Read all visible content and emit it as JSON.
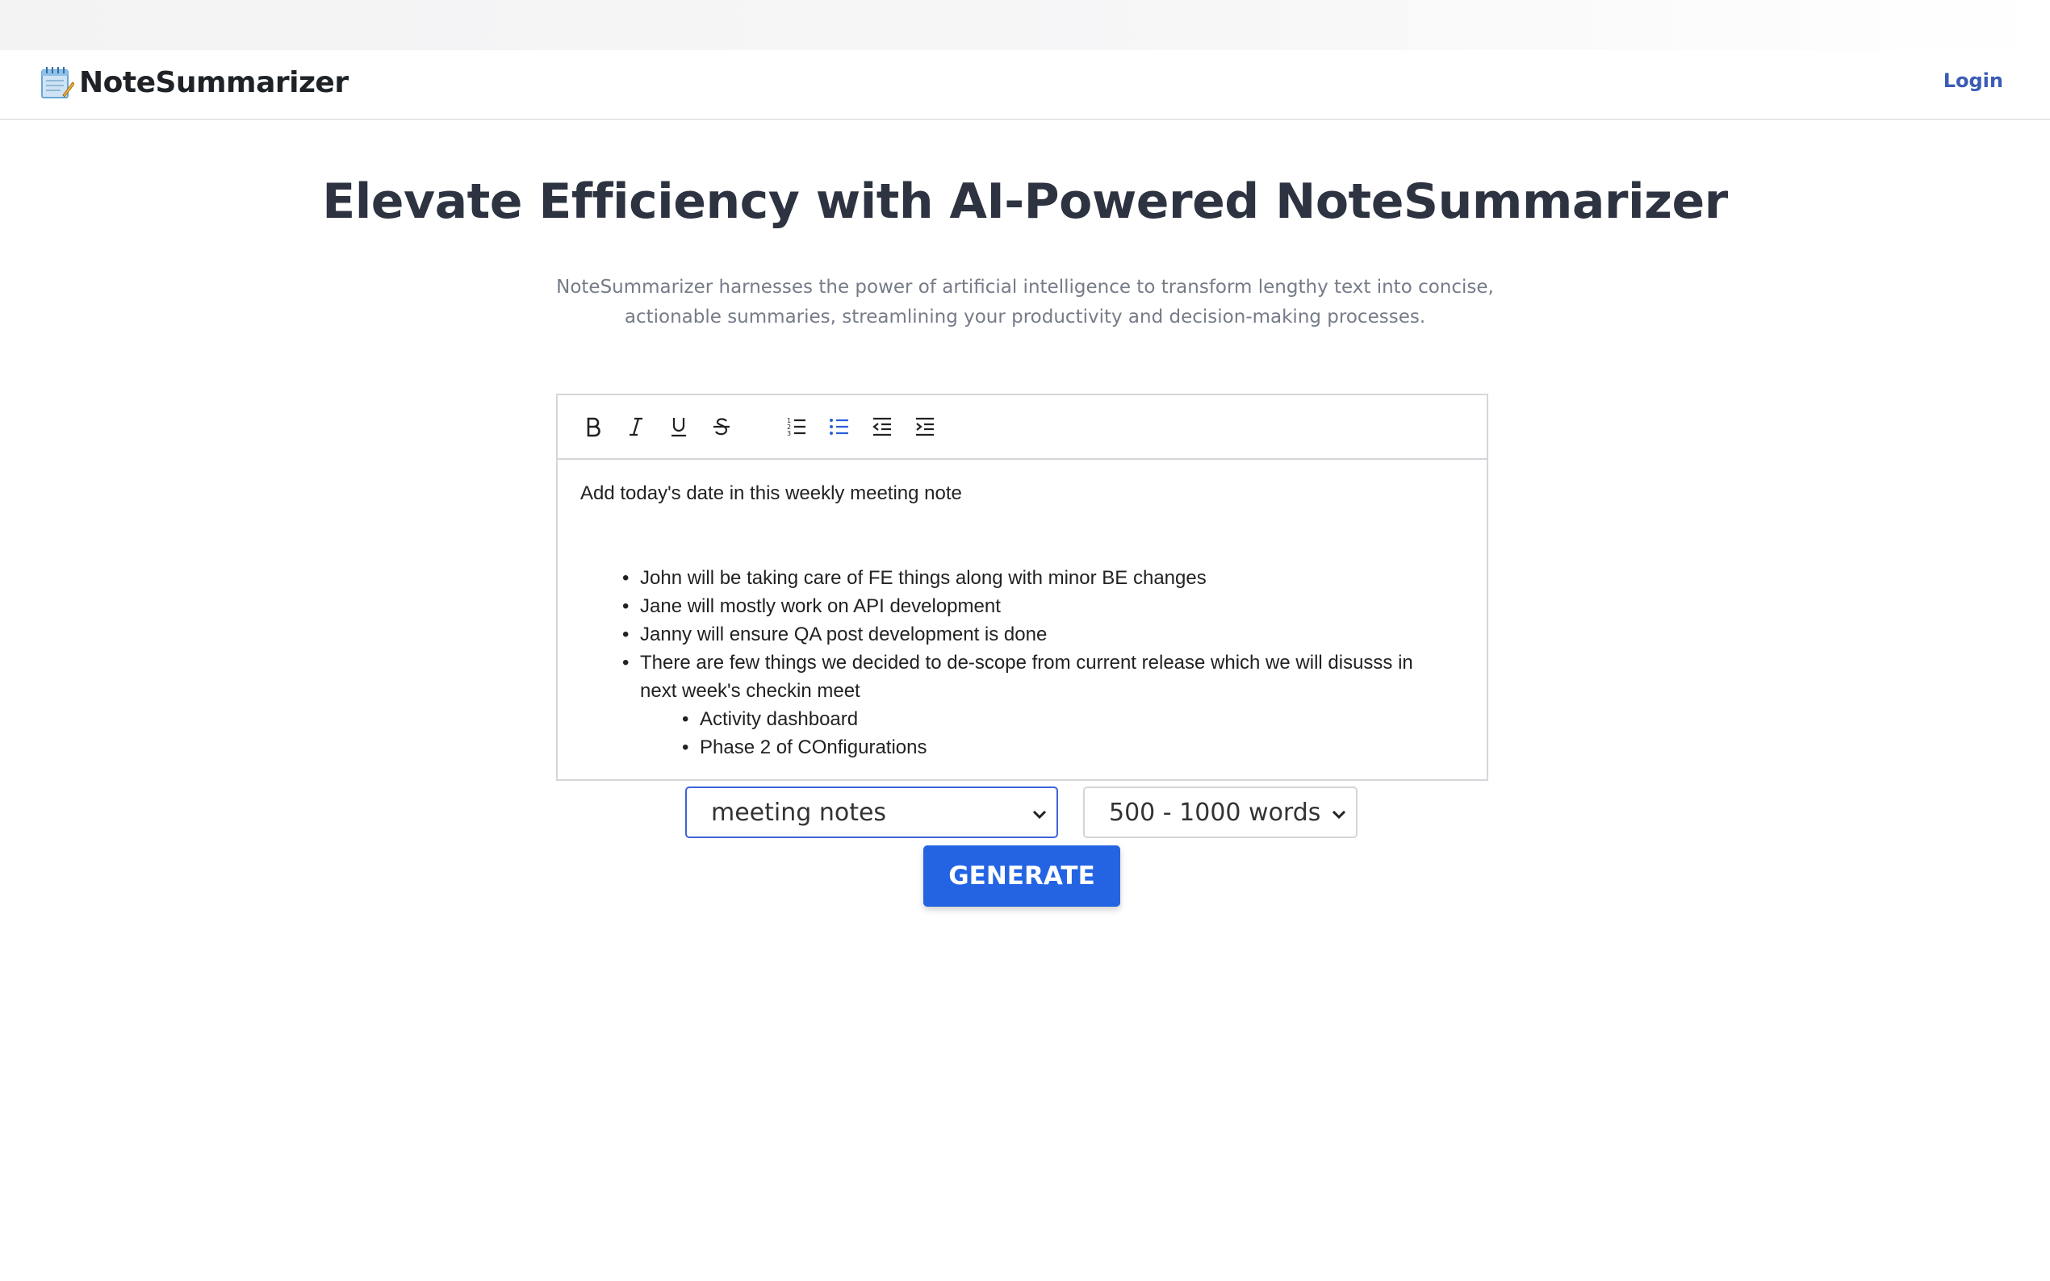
{
  "brand": {
    "name": "NoteSummarizer",
    "icon": "notepad-icon"
  },
  "nav": {
    "login_label": "Login",
    "link_color": "#3a5bb5"
  },
  "hero": {
    "title": "Elevate Efficiency with AI-Powered NoteSummarizer",
    "subtitle_line1": "NoteSummarizer harnesses the power of artificial intelligence to transform lengthy text into concise,",
    "subtitle_line2": "actionable summaries, streamlining your productivity and decision-making processes."
  },
  "editor": {
    "toolbar": [
      "bold-icon",
      "italic-icon",
      "underline-icon",
      "strikethrough-icon",
      "ordered-list-icon",
      "bullet-list-icon",
      "outdent-icon",
      "indent-icon"
    ],
    "active_tool": "bullet-list-icon",
    "first_line": "Add today's date in this weekly meeting note",
    "bullets": [
      "John will be taking care of FE things along with minor BE changes",
      "Jane will mostly work on API development",
      "Janny will ensure QA post development is done",
      "There are few things we decided to de-scope from current release which we will disusss in next week's checkin meet"
    ],
    "sub_bullets": [
      "Activity dashboard",
      "Phase 2 of COnfigurations"
    ]
  },
  "controls": {
    "note_type_selected": "meeting notes",
    "length_selected": "500 - 1000 words",
    "generate_label": "GENERATE",
    "accent": "#2464e3"
  }
}
